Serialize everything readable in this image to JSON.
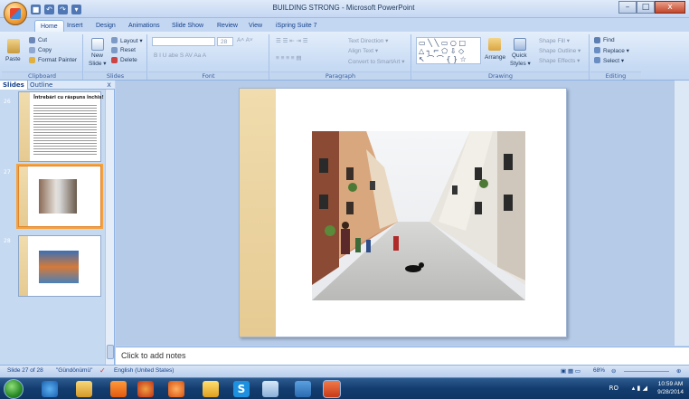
{
  "window": {
    "title": "BUILDING STRONG - Microsoft PowerPoint",
    "controls": [
      "–",
      "□",
      "x"
    ]
  },
  "tabs": [
    "Home",
    "Insert",
    "Design",
    "Animations",
    "Slide Show",
    "Review",
    "View",
    "iSpring Suite 7"
  ],
  "ribbon": {
    "clipboard": {
      "paste": "Paste",
      "cut": "Cut",
      "copy": "Copy",
      "format_painter": "Format Painter",
      "label": "Clipboard"
    },
    "slides": {
      "new_slide": "New",
      "new_slide2": "Slide ▾",
      "layout": "Layout ▾",
      "reset": "Reset",
      "delete": "Delete",
      "label": "Slides"
    },
    "font": {
      "size": "28",
      "label": "Font"
    },
    "paragraph": {
      "text_direction": "Text Direction ▾",
      "align_text": "Align Text ▾",
      "convert": "Convert to SmartArt ▾",
      "label": "Paragraph"
    },
    "drawing": {
      "arrange": "Arrange",
      "quick_styles": "Quick",
      "quick_styles2": "Styles ▾",
      "shape_fill": "Shape Fill ▾",
      "shape_outline": "Shape Outline ▾",
      "shape_effects": "Shape Effects ▾",
      "label": "Drawing"
    },
    "editing": {
      "find": "Find",
      "replace": "Replace ▾",
      "select": "Select ▾",
      "label": "Editing"
    }
  },
  "panel": {
    "tabs": [
      "Slides",
      "Outline"
    ],
    "close": "x",
    "slides": [
      {
        "number": "26",
        "title": "Întrebări cu răspuns închis!"
      },
      {
        "number": "27"
      },
      {
        "number": "28"
      }
    ]
  },
  "notes": {
    "placeholder": "Click to add notes"
  },
  "status": {
    "slide": "Slide 27 of 28",
    "theme": "\"Gündönümü\"",
    "language": "English (United States)",
    "zoom": "68%"
  },
  "taskbar": {
    "lang": "RO",
    "time": "10:59 AM",
    "date": "9/28/2014"
  },
  "colors": {
    "ribbon": "#c8dbf4",
    "selection": "#f7a23c",
    "taskbar": "#133d6f"
  }
}
